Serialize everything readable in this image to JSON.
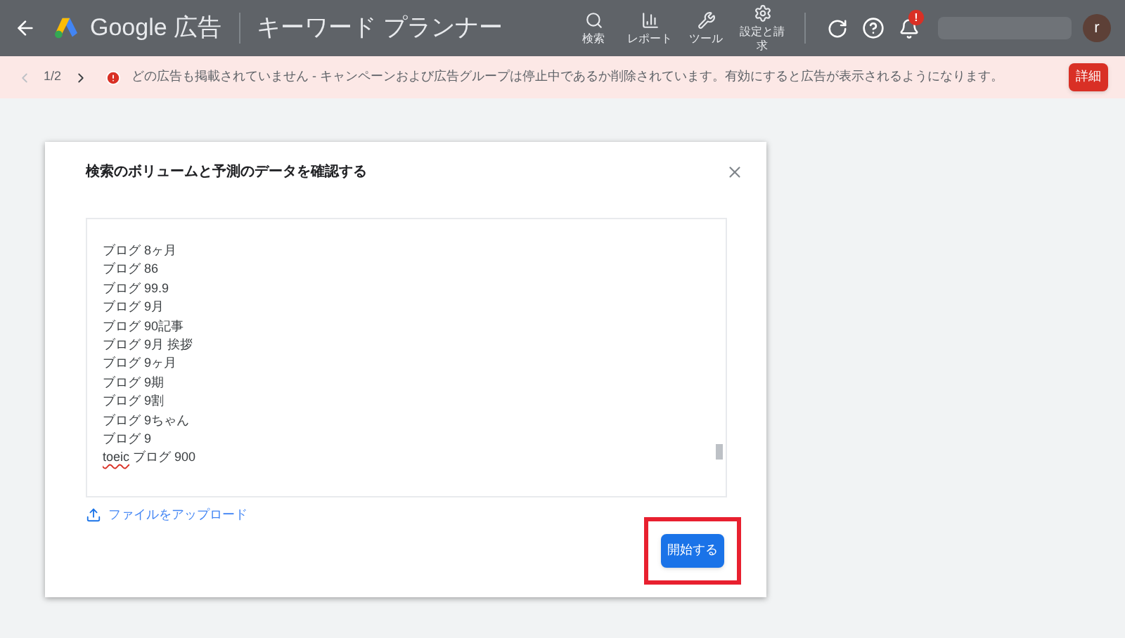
{
  "header": {
    "product": "Google 広告",
    "page_title": "キーワード プランナー",
    "tools": [
      {
        "kind": "search",
        "label": "検索"
      },
      {
        "kind": "report",
        "label": "レポート"
      },
      {
        "kind": "tool",
        "label": "ツール"
      },
      {
        "kind": "settings",
        "label": "設定と請求"
      }
    ],
    "notification_badge": "!",
    "avatar": "r"
  },
  "banner": {
    "pager": "1/2",
    "message": "どの広告も掲載されていません - キャンペーンおよび広告グループは停止中であるか削除されています。有効にすると広告が表示されるようになります。",
    "button": "詳細"
  },
  "dialog": {
    "title": "検索のボリュームと予測のデータを確認する",
    "keywords": [
      {
        "text": "ブログ 8ヶ月",
        "misspelled": false
      },
      {
        "text": "ブログ 86",
        "misspelled": false
      },
      {
        "text": "ブログ 99.9",
        "misspelled": false
      },
      {
        "text": "ブログ 9月",
        "misspelled": false
      },
      {
        "text": "ブログ 90記事",
        "misspelled": false
      },
      {
        "text": "ブログ 9月 挨拶",
        "misspelled": false
      },
      {
        "text": "ブログ 9ヶ月",
        "misspelled": false
      },
      {
        "text": "ブログ 9期",
        "misspelled": false
      },
      {
        "text": "ブログ 9割",
        "misspelled": false
      },
      {
        "text": "ブログ 9ちゃん",
        "misspelled": false
      },
      {
        "text": "ブログ 9",
        "misspelled": false
      },
      {
        "text": "toeic",
        "misspelled": true,
        "rest": " ブログ 900"
      }
    ],
    "upload": "ファイルをアップロード",
    "start_button": "開始する"
  }
}
